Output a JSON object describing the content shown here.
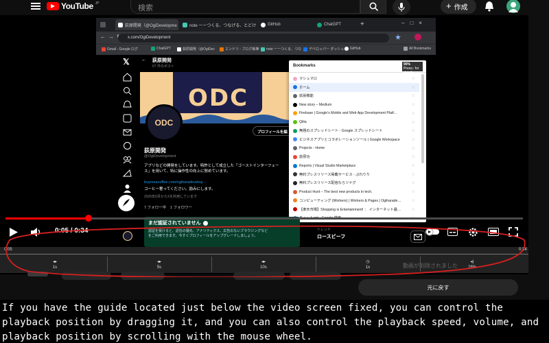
{
  "youtube": {
    "logo": "YouTube",
    "country_code": "JP",
    "search_placeholder": "検索",
    "create_label": "作成",
    "icons": {
      "menu": "menu-icon",
      "search": "search-icon",
      "mic": "mic-icon",
      "create": "plus-icon",
      "notifications": "bell-icon",
      "avatar": "user-avatar"
    }
  },
  "chrome": {
    "tabs": [
      {
        "label": "荻原開発（@OgiDevelopme",
        "color": "#ffffff",
        "active": true
      },
      {
        "label": "note ーーつくる、つなげる、とどけ",
        "color": "#41c9b4",
        "active": false
      },
      {
        "label": "GitHub",
        "color": "#ffffff",
        "active": false
      },
      {
        "label": "ChatGPT",
        "color": "#10a37f",
        "active": false
      }
    ],
    "address": "x.com/OgiDevelopment",
    "bookmark_bar": [
      {
        "label": "Gmail - Google ログ"
      },
      {
        "label": "ChatGPT"
      },
      {
        "label": "荻原開発（@OgiDev"
      },
      {
        "label": "エンドリ - ブログ執筆"
      },
      {
        "label": "note ーーつくる、つな"
      },
      {
        "label": "デベロッパー ダッシュボ"
      },
      {
        "label": "GitHub"
      }
    ],
    "all_bookmarks": "All Bookmarks"
  },
  "x_profile": {
    "back_title": "荻原開発",
    "post_count": "67 件のポスト",
    "banner_text": "ODC",
    "edit_profile": "プロフィールを編",
    "name": "荻原開発",
    "handle": "@OgiDevelopment",
    "bio": "アプリなどの開発をしています。特許として成立した「ゴーストインターフェー\nス」を用いて、特に操作性の向上に努めています。",
    "link": "buymeacoffee.com/ogiharadevelop…",
    "coffee": "コーヒー奢ってください。励みにします。",
    "joined": "2025年6月からXを利用しています",
    "following": "7 フォロー中",
    "followers": "1 フォロワー",
    "unverified_title": "まだ認証されていません",
    "unverified_body": "認証を受けると、返信の優先、アナリティクス、広告のないブラウジングなど\nをご利用できます。今すぐプロフィールをアップグレードしましょう。",
    "trend_label": "ロースビーフ",
    "trend_meta": "トレンド"
  },
  "bookmarks_panel": {
    "title": "Bookmarks",
    "zoom": "90%",
    "zoom_hint": "Press↓ for details",
    "items": [
      {
        "label": "マシュマロ",
        "color": "#f3a6c8"
      },
      {
        "label": "ホーム",
        "color": "#1a73e8"
      },
      {
        "label": "拡張機能",
        "color": "#5f6368"
      },
      {
        "label": "New story – Medium",
        "color": "#000000"
      },
      {
        "label": "Firebase | Google's Mobile and Web App Development Platf…",
        "color": "#ffa000"
      },
      {
        "label": "Qiita",
        "color": "#55c500"
      },
      {
        "label": "無題のスプレッドシート - Google スプレッドシート",
        "color": "#0f9d58"
      },
      {
        "label": "ビジネスアプリとコラボレーションツール | Google Workspace",
        "color": "#4285f4"
      },
      {
        "label": "Projects - Home",
        "color": "#5f6368"
      },
      {
        "label": "荻原功",
        "color": "#ea4335"
      },
      {
        "label": "Reports | Visual Studio Marketplace",
        "color": "#0078d4"
      },
      {
        "label": "無料プレスリリース掲載サービス - ぷれりり",
        "color": "#333333"
      },
      {
        "label": "無料プレスリリース配信ならツナグ",
        "color": "#222222"
      },
      {
        "label": "Product Hunt – The best new products in tech.",
        "color": "#da552f"
      },
      {
        "label": "コンピューティング (Workers) | Workers & Pages | Ogiharade…",
        "color": "#f38020"
      },
      {
        "label": "【楽天市場】Shopping is Entertainment! ： インターネット最…",
        "color": "#bf0000"
      },
      {
        "label": "チャットgpt - Google 検索",
        "color": "#4285f4"
      }
    ]
  },
  "player": {
    "current_time": "0:05",
    "duration": "0:34",
    "progress": 0.16,
    "guide_start": "0:05",
    "guide_end": "0:34",
    "guide_segments": [
      {
        "label": "1s",
        "icon": "seek-icon"
      },
      {
        "label": "5s",
        "icon": "seek-icon"
      },
      {
        "label": "10s",
        "icon": "seek-icon"
      },
      {
        "label": "1x",
        "icon": "speed-icon"
      },
      {
        "label": "28%",
        "icon": "volume-icon"
      }
    ],
    "ghost_text": "動画が削除されました",
    "return_label": "元に戻す"
  },
  "caption": "If you have the guide located just below the video screen fixed, you can control the playback position by dragging it, and you can also control the playback speed, volume, and playback position by scrolling with the mouse wheel.",
  "colors": {
    "accent": "#ff0000",
    "annotation": "#d62020",
    "guide_bg": "#282828"
  }
}
